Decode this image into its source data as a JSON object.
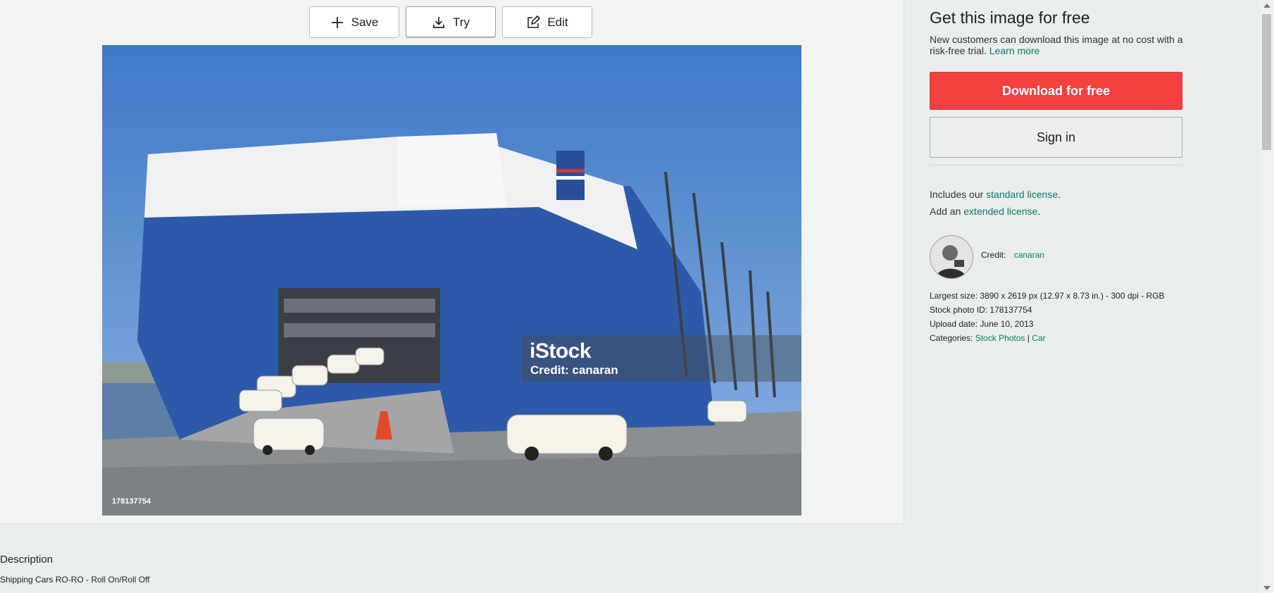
{
  "toolbar": {
    "save_label": "Save",
    "try_label": "Try",
    "edit_label": "Edit"
  },
  "image": {
    "watermark_logo": "iStock",
    "watermark_credit": "Credit: canaran",
    "photo_id": "178137754"
  },
  "description": {
    "heading": "Description",
    "text": "Shipping Cars RO-RO - Roll On/Roll Off"
  },
  "sidebar": {
    "title": "Get this image for free",
    "subtitle": "New customers can download this image at no cost with a risk-free trial.",
    "learn_more": "Learn more",
    "download_label": "Download for free",
    "signin_label": "Sign in",
    "license_prefix_1": "Includes our",
    "license_link_1": "standard license",
    "license_suffix": ".",
    "license_prefix_2": "Add an",
    "license_link_2": "extended license",
    "credit_label": "Credit:",
    "credit_name": "canaran",
    "largest_size_label": "Largest size:",
    "largest_size_value": "3890 x 2619 px (12.97 x 8.73 in.) - 300 dpi - RGB",
    "stock_id_label": "Stock photo ID:",
    "stock_id_value": "178137754",
    "upload_label": "Upload date:",
    "upload_value": "June 10, 2013",
    "categories_label": "Categories:",
    "category_1": "Stock Photos",
    "category_sep": "|",
    "category_2": "Car"
  },
  "colors": {
    "accent_link": "#0a7a6b",
    "download_button": "#f54040"
  }
}
